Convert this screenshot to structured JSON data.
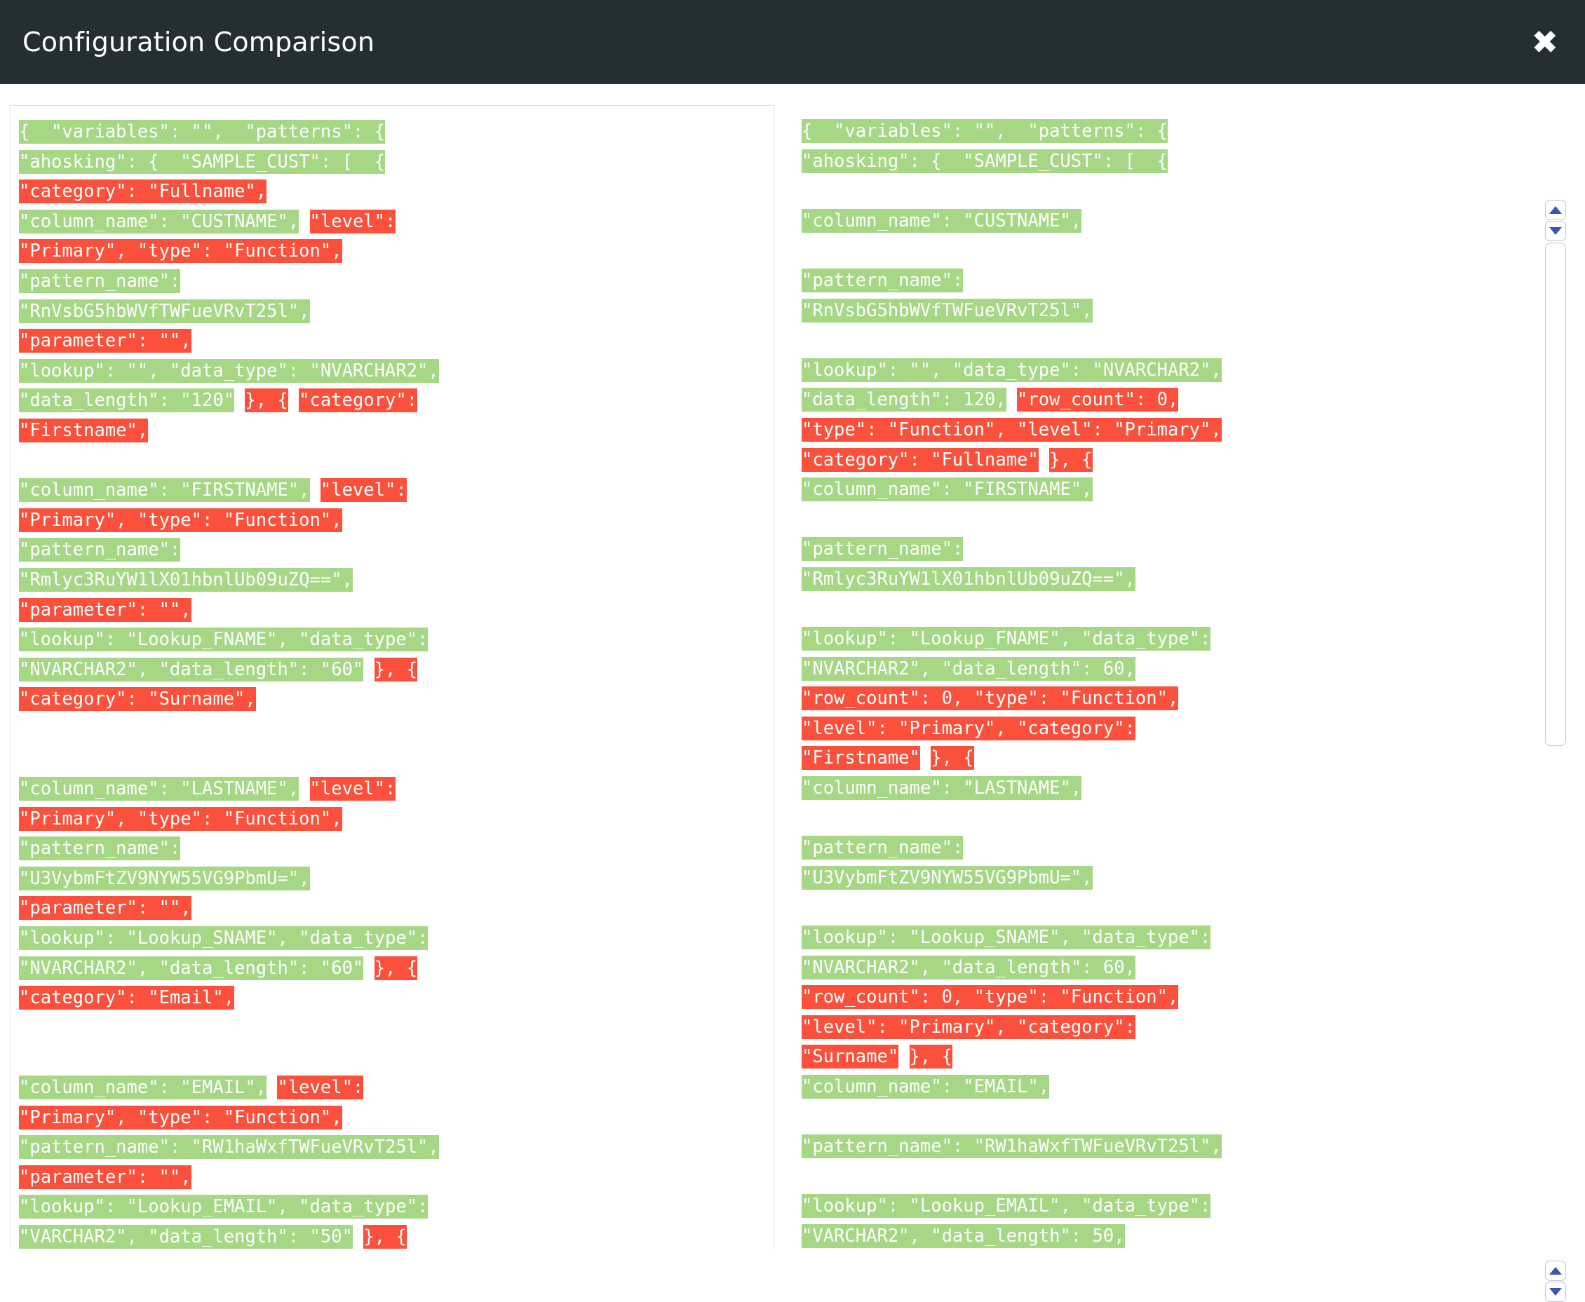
{
  "header": {
    "title": "Configuration Comparison",
    "close_label": "✖"
  },
  "panels": {
    "left": {
      "name": "left-configuration",
      "lines": [
        [
          {
            "t": "{  \"variables\": \"\",  \"patterns\": {",
            "s": "add"
          }
        ],
        [
          {
            "t": "\"ahosking\": {  \"SAMPLE_CUST\": [  {",
            "s": "add"
          }
        ],
        [
          {
            "t": "\"category\": \"Fullname\",",
            "s": "del"
          }
        ],
        [
          {
            "t": "\"column_name\": \"CUSTNAME\",",
            "s": "add"
          },
          {
            "t": " ",
            "s": "none"
          },
          {
            "t": "\"level\":",
            "s": "del"
          }
        ],
        [
          {
            "t": "\"Primary\", \"type\": \"Function\",",
            "s": "del"
          }
        ],
        [
          {
            "t": "\"pattern_name\":",
            "s": "add"
          }
        ],
        [
          {
            "t": "\"RnVsbG5hbWVfTWFueVRvT25l\",",
            "s": "add"
          }
        ],
        [
          {
            "t": "\"parameter\": \"\",",
            "s": "del"
          }
        ],
        [
          {
            "t": "\"lookup\": \"\", \"data_type\": \"NVARCHAR2\",",
            "s": "add"
          }
        ],
        [
          {
            "t": "\"data_length\": \"120\"",
            "s": "add"
          },
          {
            "t": " ",
            "s": "none"
          },
          {
            "t": "}, {",
            "s": "del"
          },
          {
            "t": " ",
            "s": "none"
          },
          {
            "t": "\"category\":",
            "s": "del"
          }
        ],
        [
          {
            "t": "\"Firstname\",",
            "s": "del"
          }
        ],
        [
          {
            "t": "",
            "s": "none"
          }
        ],
        [
          {
            "t": "\"column_name\": \"FIRSTNAME\",",
            "s": "add"
          },
          {
            "t": " ",
            "s": "none"
          },
          {
            "t": "\"level\":",
            "s": "del"
          }
        ],
        [
          {
            "t": "\"Primary\", \"type\": \"Function\",",
            "s": "del"
          }
        ],
        [
          {
            "t": "\"pattern_name\":",
            "s": "add"
          }
        ],
        [
          {
            "t": "\"Rmlyc3RuYW1lX01hbnlUb09uZQ==\",",
            "s": "add"
          }
        ],
        [
          {
            "t": "\"parameter\": \"\",",
            "s": "del"
          }
        ],
        [
          {
            "t": "\"lookup\": \"Lookup_FNAME\", \"data_type\":",
            "s": "add"
          }
        ],
        [
          {
            "t": "\"NVARCHAR2\", \"data_length\": \"60\"",
            "s": "add"
          },
          {
            "t": " ",
            "s": "none"
          },
          {
            "t": "}, {",
            "s": "del"
          }
        ],
        [
          {
            "t": "\"category\": \"Surname\",",
            "s": "del"
          }
        ],
        [
          {
            "t": "",
            "s": "none"
          }
        ],
        [
          {
            "t": "",
            "s": "none"
          }
        ],
        [
          {
            "t": "\"column_name\": \"LASTNAME\",",
            "s": "add"
          },
          {
            "t": " ",
            "s": "none"
          },
          {
            "t": "\"level\":",
            "s": "del"
          }
        ],
        [
          {
            "t": "\"Primary\", \"type\": \"Function\",",
            "s": "del"
          }
        ],
        [
          {
            "t": "\"pattern_name\":",
            "s": "add"
          }
        ],
        [
          {
            "t": "\"U3VybmFtZV9NYW55VG9PbmU=\",",
            "s": "add"
          }
        ],
        [
          {
            "t": "\"parameter\": \"\",",
            "s": "del"
          }
        ],
        [
          {
            "t": "\"lookup\": \"Lookup_SNAME\", \"data_type\":",
            "s": "add"
          }
        ],
        [
          {
            "t": "\"NVARCHAR2\", \"data_length\": \"60\"",
            "s": "add"
          },
          {
            "t": " ",
            "s": "none"
          },
          {
            "t": "}, {",
            "s": "del"
          }
        ],
        [
          {
            "t": "\"category\": \"Email\",",
            "s": "del"
          }
        ],
        [
          {
            "t": "",
            "s": "none"
          }
        ],
        [
          {
            "t": "",
            "s": "none"
          }
        ],
        [
          {
            "t": "\"column_name\": \"EMAIL\",",
            "s": "add"
          },
          {
            "t": " ",
            "s": "none"
          },
          {
            "t": "\"level\":",
            "s": "del"
          }
        ],
        [
          {
            "t": "\"Primary\", \"type\": \"Function\",",
            "s": "del"
          }
        ],
        [
          {
            "t": "\"pattern_name\": \"RW1haWxfTWFueVRvT25l\",",
            "s": "add"
          }
        ],
        [
          {
            "t": "\"parameter\": \"\",",
            "s": "del"
          }
        ],
        [
          {
            "t": "\"lookup\": \"Lookup_EMAIL\", \"data_type\":",
            "s": "add"
          }
        ],
        [
          {
            "t": "\"VARCHAR2\", \"data_length\": \"50\"",
            "s": "add"
          },
          {
            "t": " ",
            "s": "none"
          },
          {
            "t": "}, {",
            "s": "del"
          }
        ]
      ]
    },
    "right": {
      "name": "right-configuration",
      "lines": [
        [
          {
            "t": "{  \"variables\": \"\",  \"patterns\": {",
            "s": "add"
          }
        ],
        [
          {
            "t": "\"ahosking\": {  \"SAMPLE_CUST\": [  {",
            "s": "add"
          }
        ],
        [
          {
            "t": "",
            "s": "none"
          }
        ],
        [
          {
            "t": "\"column_name\": \"CUSTNAME\",",
            "s": "add"
          }
        ],
        [
          {
            "t": "",
            "s": "none"
          }
        ],
        [
          {
            "t": "\"pattern_name\":",
            "s": "add"
          }
        ],
        [
          {
            "t": "\"RnVsbG5hbWVfTWFueVRvT25l\",",
            "s": "add"
          }
        ],
        [
          {
            "t": "",
            "s": "none"
          }
        ],
        [
          {
            "t": "\"lookup\": \"\", \"data_type\": \"NVARCHAR2\",",
            "s": "add"
          }
        ],
        [
          {
            "t": "\"data_length\": 120,",
            "s": "add"
          },
          {
            "t": " ",
            "s": "none"
          },
          {
            "t": "\"row_count\": 0,",
            "s": "del"
          }
        ],
        [
          {
            "t": "\"type\": \"Function\", \"level\": \"Primary\",",
            "s": "del"
          }
        ],
        [
          {
            "t": "\"category\": \"Fullname\"",
            "s": "del"
          },
          {
            "t": " ",
            "s": "none"
          },
          {
            "t": "}, {",
            "s": "del"
          }
        ],
        [
          {
            "t": "\"column_name\": \"FIRSTNAME\",",
            "s": "add"
          }
        ],
        [
          {
            "t": "",
            "s": "none"
          }
        ],
        [
          {
            "t": "\"pattern_name\":",
            "s": "add"
          }
        ],
        [
          {
            "t": "\"Rmlyc3RuYW1lX01hbnlUb09uZQ==\",",
            "s": "add"
          }
        ],
        [
          {
            "t": "",
            "s": "none"
          }
        ],
        [
          {
            "t": "\"lookup\": \"Lookup_FNAME\", \"data_type\":",
            "s": "add"
          }
        ],
        [
          {
            "t": "\"NVARCHAR2\", \"data_length\": 60,",
            "s": "add"
          }
        ],
        [
          {
            "t": "\"row_count\": 0, \"type\": \"Function\",",
            "s": "del"
          }
        ],
        [
          {
            "t": "\"level\": \"Primary\", \"category\":",
            "s": "del"
          }
        ],
        [
          {
            "t": "\"Firstname\"",
            "s": "del"
          },
          {
            "t": " ",
            "s": "none"
          },
          {
            "t": "}, {",
            "s": "del"
          }
        ],
        [
          {
            "t": "\"column_name\": \"LASTNAME\",",
            "s": "add"
          }
        ],
        [
          {
            "t": "",
            "s": "none"
          }
        ],
        [
          {
            "t": "\"pattern_name\":",
            "s": "add"
          }
        ],
        [
          {
            "t": "\"U3VybmFtZV9NYW55VG9PbmU=\",",
            "s": "add"
          }
        ],
        [
          {
            "t": "",
            "s": "none"
          }
        ],
        [
          {
            "t": "\"lookup\": \"Lookup_SNAME\", \"data_type\":",
            "s": "add"
          }
        ],
        [
          {
            "t": "\"NVARCHAR2\", \"data_length\": 60,",
            "s": "add"
          }
        ],
        [
          {
            "t": "\"row_count\": 0, \"type\": \"Function\",",
            "s": "del"
          }
        ],
        [
          {
            "t": "\"level\": \"Primary\", \"category\":",
            "s": "del"
          }
        ],
        [
          {
            "t": "\"Surname\"",
            "s": "del"
          },
          {
            "t": " ",
            "s": "none"
          },
          {
            "t": "}, {",
            "s": "del"
          }
        ],
        [
          {
            "t": "\"column_name\": \"EMAIL\",",
            "s": "add"
          }
        ],
        [
          {
            "t": "",
            "s": "none"
          }
        ],
        [
          {
            "t": "\"pattern_name\": \"RW1haWxfTWFueVRvT25l\",",
            "s": "add"
          }
        ],
        [
          {
            "t": "",
            "s": "none"
          }
        ],
        [
          {
            "t": "\"lookup\": \"Lookup_EMAIL\", \"data_type\":",
            "s": "add"
          }
        ],
        [
          {
            "t": "\"VARCHAR2\", \"data_length\": 50,",
            "s": "add"
          }
        ]
      ]
    }
  },
  "scrollbars": {
    "top": {
      "up_label": "▲",
      "down_label": "▼"
    },
    "bottom": {
      "up_label": "▲",
      "down_label": "▼"
    }
  },
  "colors": {
    "header_bg": "#232F34",
    "added": "#a6d785",
    "deleted": "#fb503b",
    "panel_border": "#e2e2e2",
    "scroll_arrow": "#3a56ad"
  }
}
